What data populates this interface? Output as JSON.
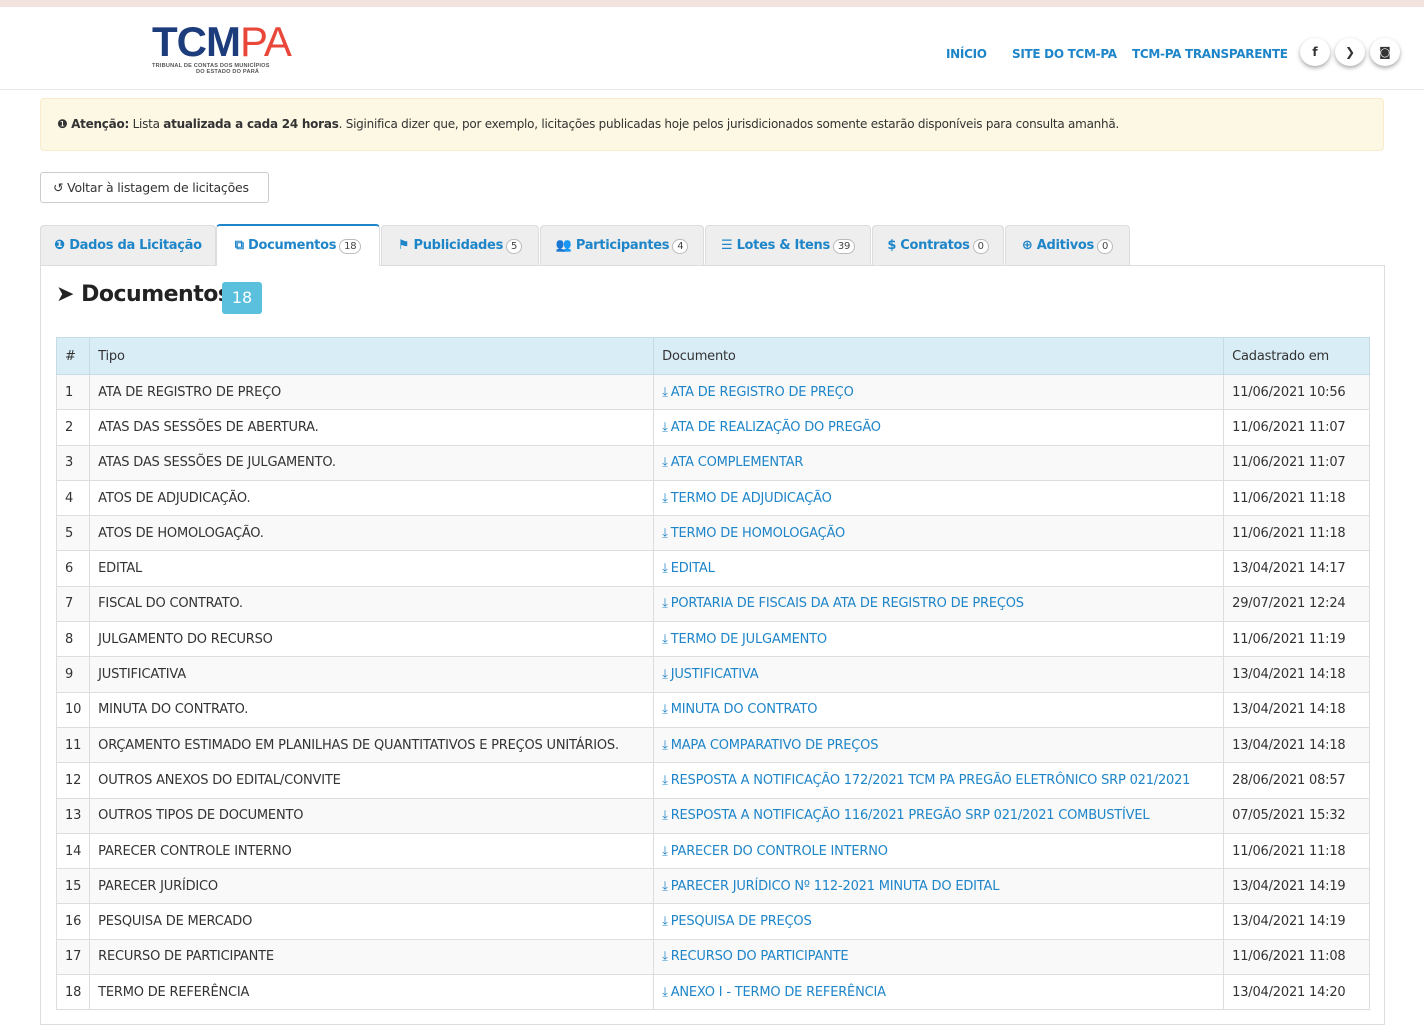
{
  "header": {
    "logo_main": "TCM",
    "logo_pa": "PA",
    "logo_sub1": "TRIBUNAL DE CONTAS DOS MUNICÍPIOS",
    "logo_sub2": "DO ESTADO DO PARÁ",
    "nav": [
      "INÍCIO",
      "SITE DO TCM-PA",
      "TCM-PA TRANSPARENTE"
    ],
    "social": [
      {
        "icon": "facebook-icon",
        "glyph": "f"
      },
      {
        "icon": "twitter-icon",
        "glyph": "❯"
      },
      {
        "icon": "instagram-icon",
        "glyph": "◙"
      }
    ]
  },
  "alert": {
    "label": "Atenção:",
    "text_pre": " Lista ",
    "text_bold": "atualizada a cada 24 horas",
    "text_post": ". Siginifica dizer que, por exemplo, licitações publicadas hoje pelos jurisdicionados somente estarão disponíveis para consulta amanhã."
  },
  "back_button": "Voltar à listagem de licitações",
  "tabs": [
    {
      "label": "Dados da Licitação",
      "count": "",
      "icon": "info-icon",
      "glyph": "❶"
    },
    {
      "label": "Documentos",
      "count": "18",
      "icon": "documents-icon",
      "glyph": "⧉",
      "active": true
    },
    {
      "label": "Publicidades",
      "count": "5",
      "icon": "flag-icon",
      "glyph": "⚑"
    },
    {
      "label": "Participantes",
      "count": "4",
      "icon": "users-icon",
      "glyph": "👥"
    },
    {
      "label": "Lotes & Itens",
      "count": "39",
      "icon": "list-icon",
      "glyph": "☰"
    },
    {
      "label": "Contratos",
      "count": "0",
      "icon": "dollar-icon",
      "glyph": "$"
    },
    {
      "label": "Aditivos",
      "count": "0",
      "icon": "plus-circle-icon",
      "glyph": "⊕"
    }
  ],
  "section": {
    "title": "Documentos",
    "count": "18"
  },
  "table": {
    "headers": [
      "#",
      "Tipo",
      "Documento",
      "Cadastrado em"
    ],
    "rows": [
      [
        "1",
        "ATA DE REGISTRO DE PREÇO",
        "ATA DE REGISTRO DE PREÇO",
        "11/06/2021 10:56"
      ],
      [
        "2",
        "ATAS DAS SESSÕES DE ABERTURA.",
        "ATA DE REALIZAÇÃO DO PREGÃO",
        "11/06/2021 11:07"
      ],
      [
        "3",
        "ATAS DAS SESSÕES DE JULGAMENTO.",
        "ATA COMPLEMENTAR",
        "11/06/2021 11:07"
      ],
      [
        "4",
        "ATOS DE ADJUDICAÇÃO.",
        "TERMO DE ADJUDICAÇÃO",
        "11/06/2021 11:18"
      ],
      [
        "5",
        "ATOS DE HOMOLOGAÇÃO.",
        "TERMO DE HOMOLOGAÇÃO",
        "11/06/2021 11:18"
      ],
      [
        "6",
        "EDITAL",
        "EDITAL",
        "13/04/2021 14:17"
      ],
      [
        "7",
        "FISCAL DO CONTRATO.",
        "PORTARIA DE FISCAIS DA ATA DE REGISTRO DE PREÇOS",
        "29/07/2021 12:24"
      ],
      [
        "8",
        "JULGAMENTO DO RECURSO",
        "TERMO DE JULGAMENTO",
        "11/06/2021 11:19"
      ],
      [
        "9",
        "JUSTIFICATIVA",
        "JUSTIFICATIVA",
        "13/04/2021 14:18"
      ],
      [
        "10",
        "MINUTA DO CONTRATO.",
        "MINUTA DO CONTRATO",
        "13/04/2021 14:18"
      ],
      [
        "11",
        "ORÇAMENTO ESTIMADO EM PLANILHAS DE QUANTITATIVOS E PREÇOS UNITÁRIOS.",
        "MAPA COMPARATIVO DE PREÇOS",
        "13/04/2021 14:18"
      ],
      [
        "12",
        "OUTROS ANEXOS DO EDITAL/CONVITE",
        "RESPOSTA A NOTIFICAÇÃO 172/2021 TCM PA PREGÃO ELETRÔNICO SRP 021/2021",
        "28/06/2021 08:57"
      ],
      [
        "13",
        "OUTROS TIPOS DE DOCUMENTO",
        "RESPOSTA A NOTIFICAÇÃO 116/2021 PREGÃO SRP 021/2021 COMBUSTÍVEL",
        "07/05/2021 15:32"
      ],
      [
        "14",
        "PARECER CONTROLE INTERNO",
        "PARECER DO CONTROLE INTERNO",
        "11/06/2021 11:18"
      ],
      [
        "15",
        "PARECER JURÍDICO",
        "PARECER JURÍDICO Nº 112-2021 MINUTA DO EDITAL",
        "13/04/2021 14:19"
      ],
      [
        "16",
        "PESQUISA DE MERCADO",
        "PESQUISA DE PREÇOS",
        "13/04/2021 14:19"
      ],
      [
        "17",
        "RECURSO DE PARTICIPANTE",
        "RECURSO DO PARTICIPANTE",
        "11/06/2021 11:08"
      ],
      [
        "18",
        "TERMO DE REFERÊNCIA",
        "ANEXO I - TERMO DE REFERÊNCIA",
        "13/04/2021 14:20"
      ]
    ]
  },
  "colors": {
    "link": "#1e85c9",
    "alert_bg": "#fcf8e3",
    "header_row": "#d9edf7",
    "count_badge": "#5bc0de"
  }
}
